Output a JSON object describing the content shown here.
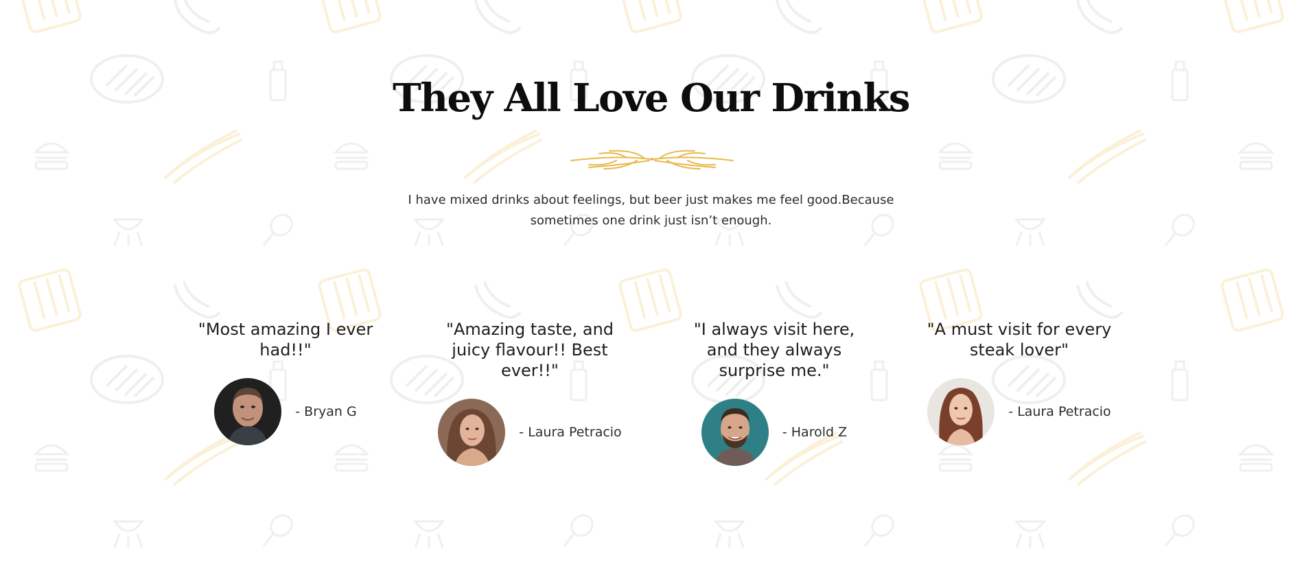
{
  "section": {
    "title": "They All Love Our Drinks",
    "intro": "I have mixed drinks about feelings, but beer just makes me feel good.Because sometimes one drink just isn’t enough."
  },
  "testimonials": [
    {
      "quote": "\"Most amazing I ever had!!\"",
      "author": "- Bryan G"
    },
    {
      "quote": "\"Amazing taste, and juicy flavour!! Best ever!!\"",
      "author": "- Laura Petracio"
    },
    {
      "quote": "\"I always visit here, and they always surprise me.\"",
      "author": "- Harold Z"
    },
    {
      "quote": "\"A must visit for every steak lover\"",
      "author": "- Laura Petracio"
    }
  ],
  "colors": {
    "accent": "#e8b84a",
    "pattern": "#f2f2f2",
    "pattern_warm": "#fbf1d9",
    "text": "#1d1d1d"
  }
}
